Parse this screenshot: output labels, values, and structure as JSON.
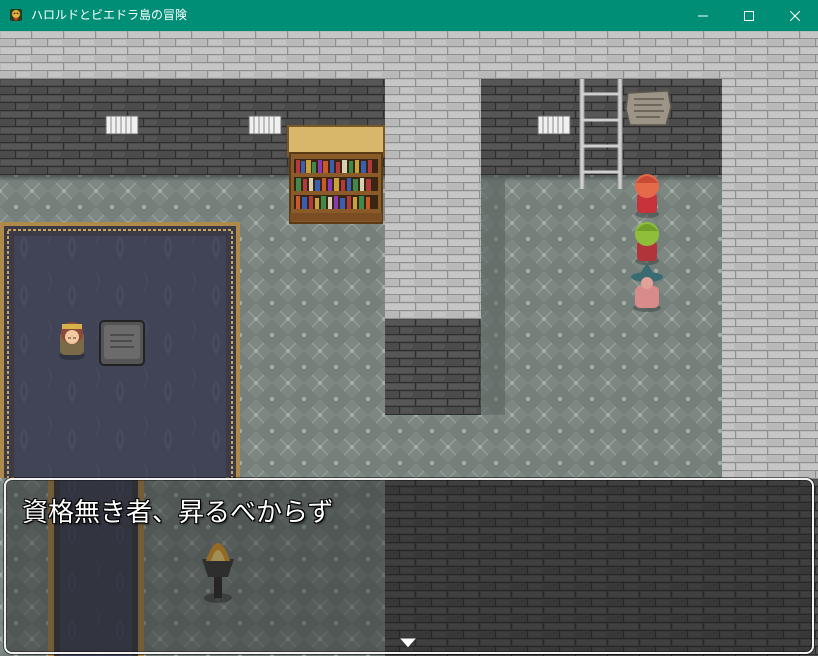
{
  "window": {
    "title": "ハロルドとビエドラ島の冒険",
    "app_icon": "game-app-icon",
    "controls": {
      "minimize_icon": "minimize-icon",
      "maximize_icon": "maximize-icon",
      "close_icon": "close-icon"
    }
  },
  "map": {
    "name": "",
    "objects": [
      "bookshelf",
      "iron-ladder",
      "engraved-stone-plaque",
      "barred-wall-vents",
      "carpet-rug",
      "stone-tablet",
      "lit-brazier",
      "party-hero-red-hair",
      "party-member-green-hair",
      "party-member-witch-hat",
      "npc-sage"
    ]
  },
  "message": {
    "text": "資格無き者、昇るべからず",
    "pause_indicator": "down-arrow-icon"
  },
  "colors": {
    "titlebar": "#008f76",
    "floor": "#7f8a85",
    "wall_brick": "#4a4a4a",
    "pillar_brick": "#bcbcbc",
    "carpet": "#414457",
    "carpet_border": "#b08a4a"
  }
}
